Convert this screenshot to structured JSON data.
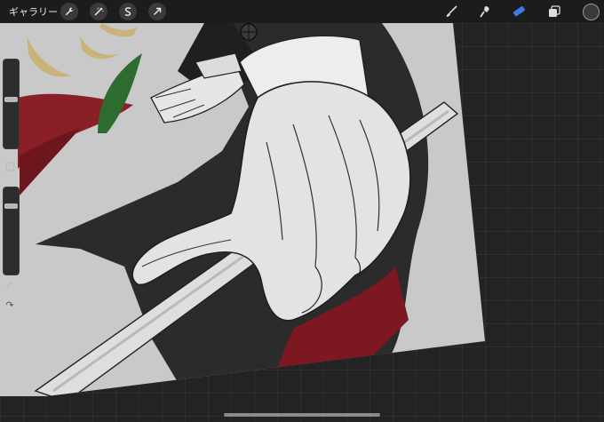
{
  "app": {
    "gallery_label": "ギャラリー"
  },
  "toolbar": {
    "left_tools": [
      {
        "name": "actions",
        "icon": "wrench-icon"
      },
      {
        "name": "adjustments",
        "icon": "magic-wand-icon"
      },
      {
        "name": "selection",
        "icon": "selection-s-icon"
      },
      {
        "name": "transform",
        "icon": "arrow-cursor-icon"
      }
    ],
    "right_tools": [
      {
        "name": "brush",
        "icon": "brush-icon",
        "active": false
      },
      {
        "name": "smudge",
        "icon": "smudge-icon",
        "active": false
      },
      {
        "name": "eraser",
        "icon": "eraser-icon",
        "active": true
      },
      {
        "name": "layers",
        "icon": "layers-icon",
        "active": false
      }
    ],
    "current_color": "#3a3a3a",
    "active_color": "#3d7be8"
  },
  "sidebar": {
    "brush_size_level": 0.55,
    "opacity_level": 0.8,
    "undo_icon": "undo-icon",
    "redo_icon": "redo-icon",
    "modify_button_icon": "square-icon",
    "undo_glyph": "↶",
    "redo_glyph": "↷"
  }
}
